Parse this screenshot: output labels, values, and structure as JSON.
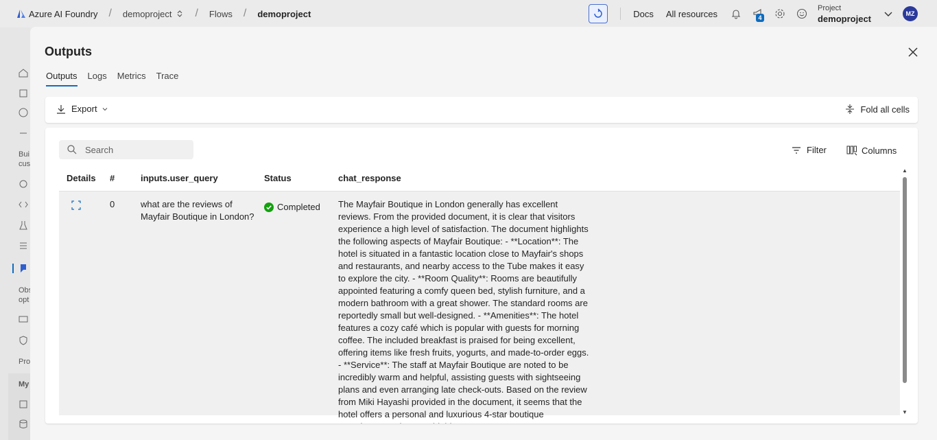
{
  "topbar": {
    "brand": "Azure AI Foundry",
    "crumbs": [
      "demoproject",
      "Flows",
      "demoproject"
    ],
    "docs": "Docs",
    "all_resources": "All resources",
    "notification_count": "4",
    "project_label": "Project",
    "project_name": "demoproject",
    "avatar_initials": "MZ"
  },
  "rail": {
    "text1": "Bui",
    "text2": "cus",
    "text3": "Obs",
    "text4": "opt",
    "text5": "Pro",
    "text6": "My"
  },
  "panel": {
    "title": "Outputs",
    "tabs": [
      {
        "label": "Outputs",
        "active": true
      },
      {
        "label": "Logs"
      },
      {
        "label": "Metrics"
      },
      {
        "label": "Trace"
      }
    ],
    "export_label": "Export",
    "fold_label": "Fold all cells",
    "search_placeholder": "Search",
    "filter_label": "Filter",
    "columns_label": "Columns"
  },
  "table": {
    "headers": [
      "Details",
      "#",
      "inputs.user_query",
      "Status",
      "chat_response"
    ],
    "rows": [
      {
        "index": "0",
        "user_query": "what are the reviews of Mayfair Boutique in London?",
        "status": "Completed",
        "chat_response": "The Mayfair Boutique in London generally has excellent reviews. From the provided document, it is clear that visitors experience a high level of satisfaction. The document highlights the following aspects of Mayfair Boutique: - **Location**: The hotel is situated in a fantastic location close to Mayfair's shops and restaurants, and nearby access to the Tube makes it easy to explore the city. - **Room Quality**: Rooms are beautifully appointed featuring a comfy queen bed, stylish furniture, and a modern bathroom with a great shower. The standard rooms are reportedly small but well-designed. - **Amenities**: The hotel features a cozy café which is popular with guests for morning coffee. The included breakfast is praised for being excellent, offering items like fresh fruits, yogurts, and made-to-order eggs. - **Service**: The staff at Mayfair Boutique are noted to be incredibly warm and helpful, assisting guests with sightseeing plans and even arranging late check-outs. Based on the review from Miki Hayashi provided in the document, it seems that the hotel offers a personal and luxurious 4-star boutique experience, and comes highly"
      }
    ]
  },
  "colors": {
    "accent": "#0f6cbd",
    "success": "#13a10e",
    "avatar": "#2b3a9a"
  }
}
